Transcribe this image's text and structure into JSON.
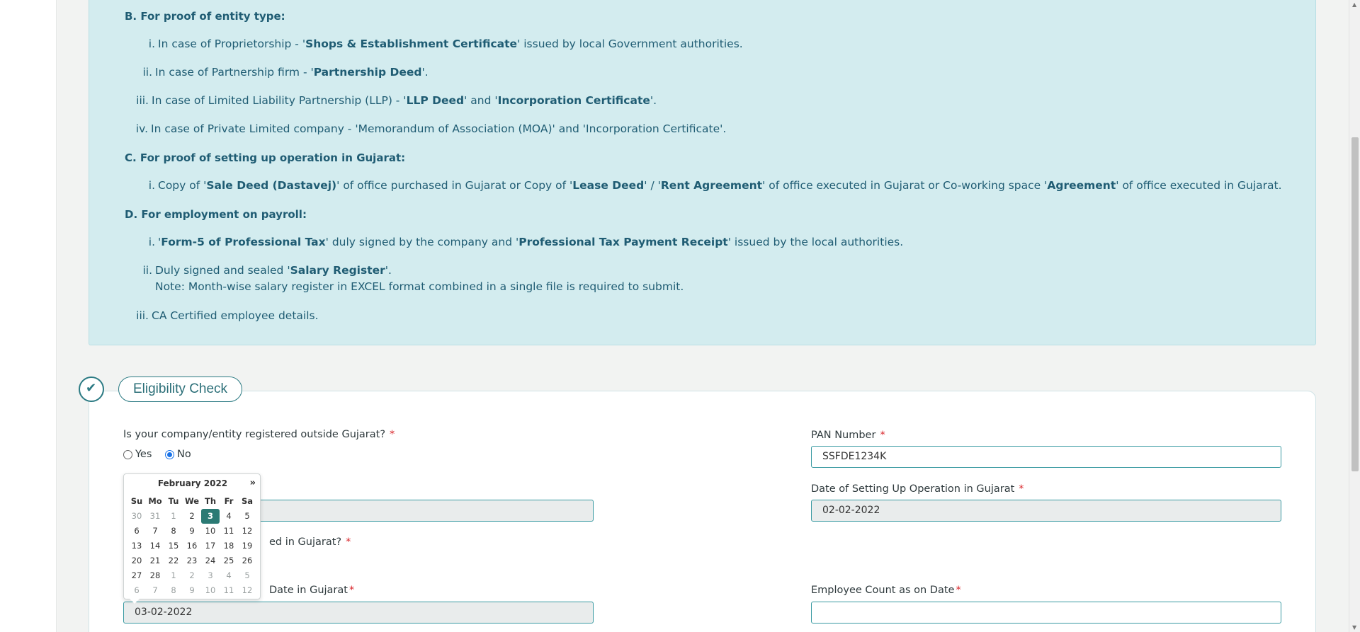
{
  "docs": {
    "sections": [
      {
        "heading": "B. For proof of entity type:",
        "items": [
          {
            "num": "i.",
            "parts": [
              [
                "In case of Proprietorship - '",
                false
              ],
              [
                "Shops & Establishment Certificate",
                true
              ],
              [
                "' issued by local Government authorities.",
                false
              ]
            ]
          },
          {
            "num": "ii.",
            "parts": [
              [
                "In case of Partnership firm - '",
                false
              ],
              [
                "Partnership Deed",
                true
              ],
              [
                "'.",
                false
              ]
            ]
          },
          {
            "num": "iii.",
            "parts": [
              [
                "In case of Limited Liability Partnership (LLP) - '",
                false
              ],
              [
                "LLP Deed",
                true
              ],
              [
                "' and '",
                false
              ],
              [
                "Incorporation Certificate",
                true
              ],
              [
                "'.",
                false
              ]
            ]
          },
          {
            "num": "iv.",
            "parts": [
              [
                "In case of Private Limited company - 'Memorandum of Association (MOA)' and 'Incorporation Certificate'.",
                false
              ]
            ]
          }
        ]
      },
      {
        "heading": "C. For proof of setting up operation in Gujarat:",
        "items": [
          {
            "num": "i.",
            "parts": [
              [
                "Copy of '",
                false
              ],
              [
                "Sale Deed (Dastavej)",
                true
              ],
              [
                "' of office purchased in Gujarat or Copy of '",
                false
              ],
              [
                "Lease Deed",
                true
              ],
              [
                "' / '",
                false
              ],
              [
                "Rent Agreement",
                true
              ],
              [
                "' of office executed in Gujarat or Co-working space '",
                false
              ],
              [
                "Agreement",
                true
              ],
              [
                "' of office executed in Gujarat.",
                false
              ]
            ]
          }
        ]
      },
      {
        "heading": "D. For employment on payroll:",
        "items": [
          {
            "num": "i.",
            "parts": [
              [
                "'",
                false
              ],
              [
                "Form-5 of Professional Tax",
                true
              ],
              [
                "' duly signed by the company and '",
                false
              ],
              [
                "Professional Tax Payment Receipt",
                true
              ],
              [
                "' issued by the local authorities.",
                false
              ]
            ]
          },
          {
            "num": "ii.",
            "parts": [
              [
                "Duly signed and sealed '",
                false
              ],
              [
                "Salary Register",
                true
              ],
              [
                "'.",
                false
              ]
            ],
            "note": "Note: Month-wise salary register in EXCEL format combined in a single file is required to submit."
          },
          {
            "num": "iii.",
            "parts": [
              [
                "CA Certified employee details.",
                false
              ]
            ]
          }
        ]
      }
    ]
  },
  "eligibility": {
    "title": "Eligibility Check",
    "check_icon": "✔",
    "q_outside_gujarat": "Is your company/entity registered outside Gujarat?",
    "radio_yes": "Yes",
    "radio_no": "No",
    "radio_selected": "No",
    "q_partial": "ed in Gujarat?",
    "label_partial_date": "Date in Gujarat",
    "date_value_left": "03-02-2022",
    "pan_label": "PAN Number",
    "pan_value": "SSFDE1234K",
    "setup_date_label": "Date of Setting Up Operation in Gujarat",
    "setup_date_value": "02-02-2022",
    "employee_count_label": "Employee Count as on Date",
    "employee_count_value": "",
    "required_mark": "*"
  },
  "datepicker": {
    "month_label": "February 2022",
    "next_label": "»",
    "weekdays": [
      "Su",
      "Mo",
      "Tu",
      "We",
      "Th",
      "Fr",
      "Sa"
    ],
    "weeks": [
      [
        [
          "30",
          "m"
        ],
        [
          "31",
          "m"
        ],
        [
          "1",
          "m"
        ],
        [
          "2",
          ""
        ],
        [
          "3",
          "sel"
        ],
        [
          "4",
          ""
        ],
        [
          "5",
          ""
        ]
      ],
      [
        [
          "6",
          ""
        ],
        [
          "7",
          ""
        ],
        [
          "8",
          ""
        ],
        [
          "9",
          ""
        ],
        [
          "10",
          ""
        ],
        [
          "11",
          ""
        ],
        [
          "12",
          ""
        ]
      ],
      [
        [
          "13",
          ""
        ],
        [
          "14",
          ""
        ],
        [
          "15",
          ""
        ],
        [
          "16",
          ""
        ],
        [
          "17",
          ""
        ],
        [
          "18",
          ""
        ],
        [
          "19",
          ""
        ]
      ],
      [
        [
          "20",
          ""
        ],
        [
          "21",
          ""
        ],
        [
          "22",
          ""
        ],
        [
          "23",
          ""
        ],
        [
          "24",
          ""
        ],
        [
          "25",
          ""
        ],
        [
          "26",
          ""
        ]
      ],
      [
        [
          "27",
          ""
        ],
        [
          "28",
          ""
        ],
        [
          "1",
          "m"
        ],
        [
          "2",
          "m"
        ],
        [
          "3",
          "m"
        ],
        [
          "4",
          "m"
        ],
        [
          "5",
          "m"
        ]
      ],
      [
        [
          "6",
          "m"
        ],
        [
          "7",
          "m"
        ],
        [
          "8",
          "m"
        ],
        [
          "9",
          "m"
        ],
        [
          "10",
          "m"
        ],
        [
          "11",
          "m"
        ],
        [
          "12",
          "m"
        ]
      ]
    ]
  },
  "colors": {
    "accent": "#2b7a83",
    "panel_bg": "#d3ecef",
    "panel_text": "#1f5c73",
    "required": "#d9262b",
    "selected_day": "#2b7a74"
  }
}
